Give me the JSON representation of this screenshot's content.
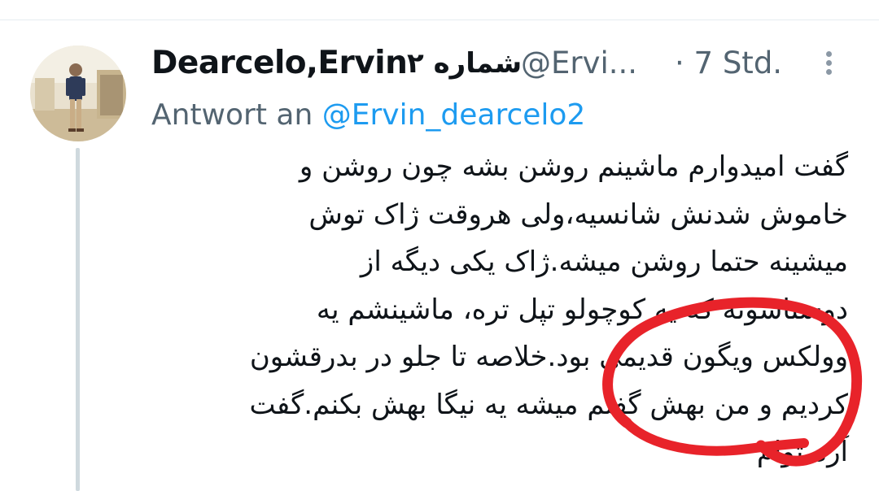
{
  "tweet": {
    "display_name": "Dearcelo,Ervin",
    "display_name_fa": "شماره ۲",
    "handle": "@Ervi...",
    "time": "· 7 Std.",
    "reply_prefix": "Antwort an ",
    "reply_handle": "@Ervin_dearcelo2",
    "body_lines": [
      "گفت امیدوارم ماشینم روشن بشه چون روشن و",
      "خاموش شدنش شانسیه،ولی هروقت ژاک توش",
      "میشینه حتما روشن میشه.ژاک یکی دیگه از",
      "دوستاشونه که یه کوچولو تپل تره، ماشینشم یه",
      "وولکس ویگون قدیمی بود.خلاصه تا جلو در بدرقشون",
      "کردیم و من بهش گفتم میشه یه نیگا بهش بکنم.گفت",
      "آره،توام"
    ]
  },
  "icons": {
    "more": "more-vertical-icon",
    "avatar": "avatar-photo"
  },
  "colors": {
    "name": "#0f1419",
    "secondary": "#536471",
    "link": "#1d9bf0",
    "annotation": "#e8232a",
    "thread_line": "#cfd9de"
  }
}
